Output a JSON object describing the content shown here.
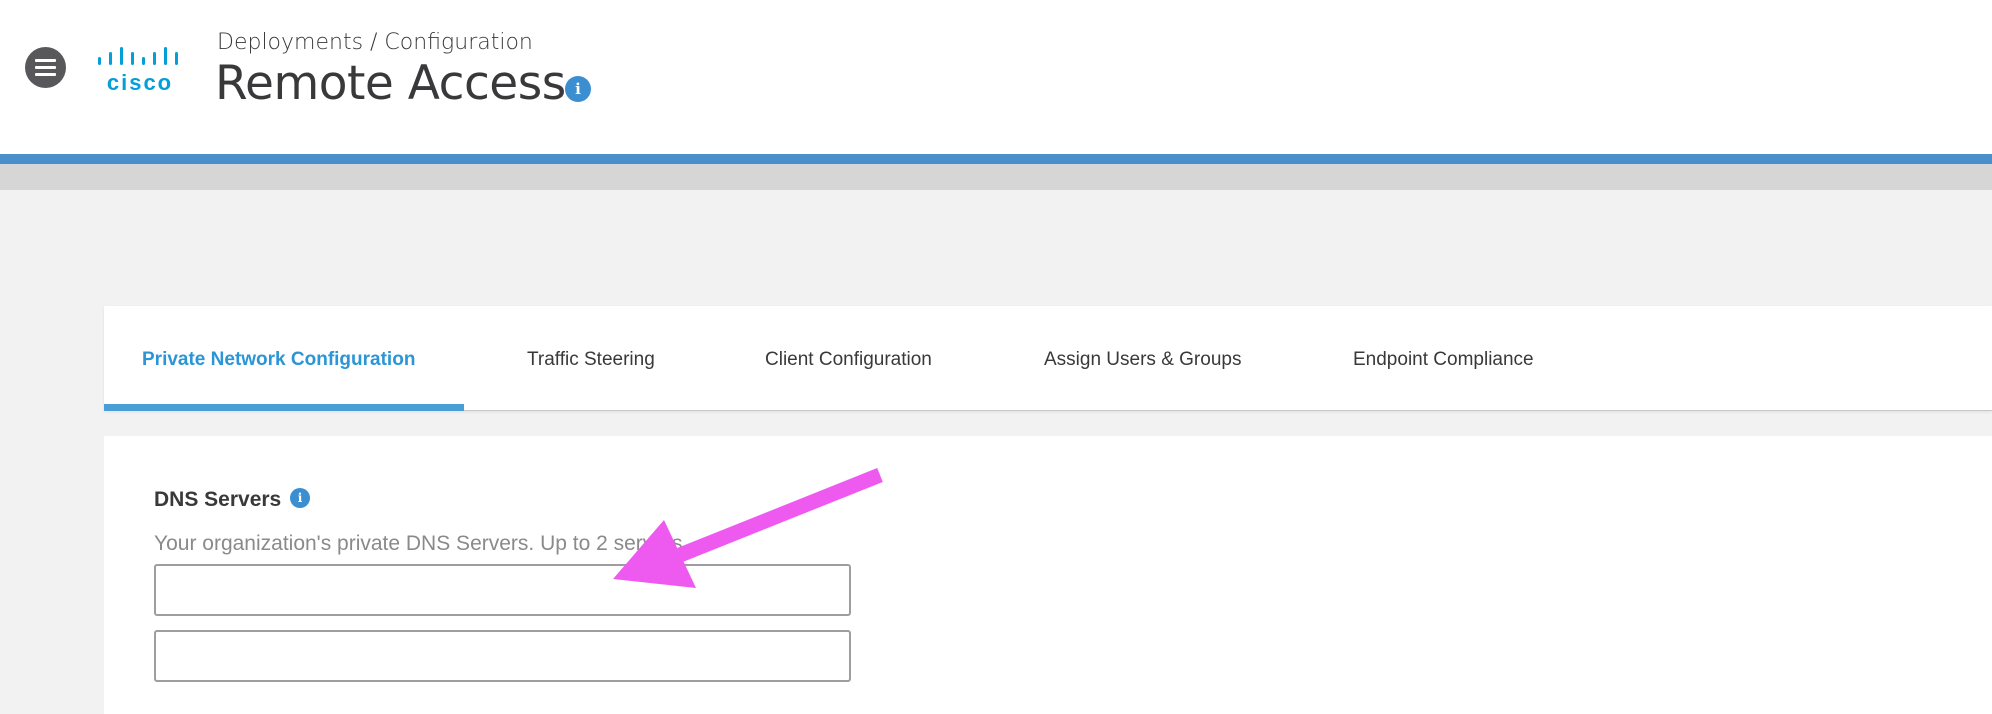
{
  "header": {
    "menu_icon": "hamburger-menu-icon",
    "logo_text": "cisco",
    "breadcrumb": "Deployments / Configuration",
    "title": "Remote Access",
    "info_icon": "info-icon",
    "info_glyph": "i"
  },
  "tabs": [
    {
      "label": "Private Network Configuration",
      "active": true
    },
    {
      "label": "Traffic Steering",
      "active": false
    },
    {
      "label": "Client Configuration",
      "active": false
    },
    {
      "label": "Assign Users & Groups",
      "active": false
    },
    {
      "label": "Endpoint Compliance",
      "active": false
    }
  ],
  "dns": {
    "label": "DNS Servers",
    "info_glyph": "i",
    "help_text": "Your organization's private DNS Servers. Up to 2 servers.",
    "inputs": [
      {
        "value": "",
        "placeholder": ""
      },
      {
        "value": "",
        "placeholder": ""
      }
    ]
  },
  "colors": {
    "brand_blue": "#049fd9",
    "active_tab": "#2b95d6",
    "header_bar": "#4990cb",
    "annotation_arrow": "#ee5af0"
  }
}
